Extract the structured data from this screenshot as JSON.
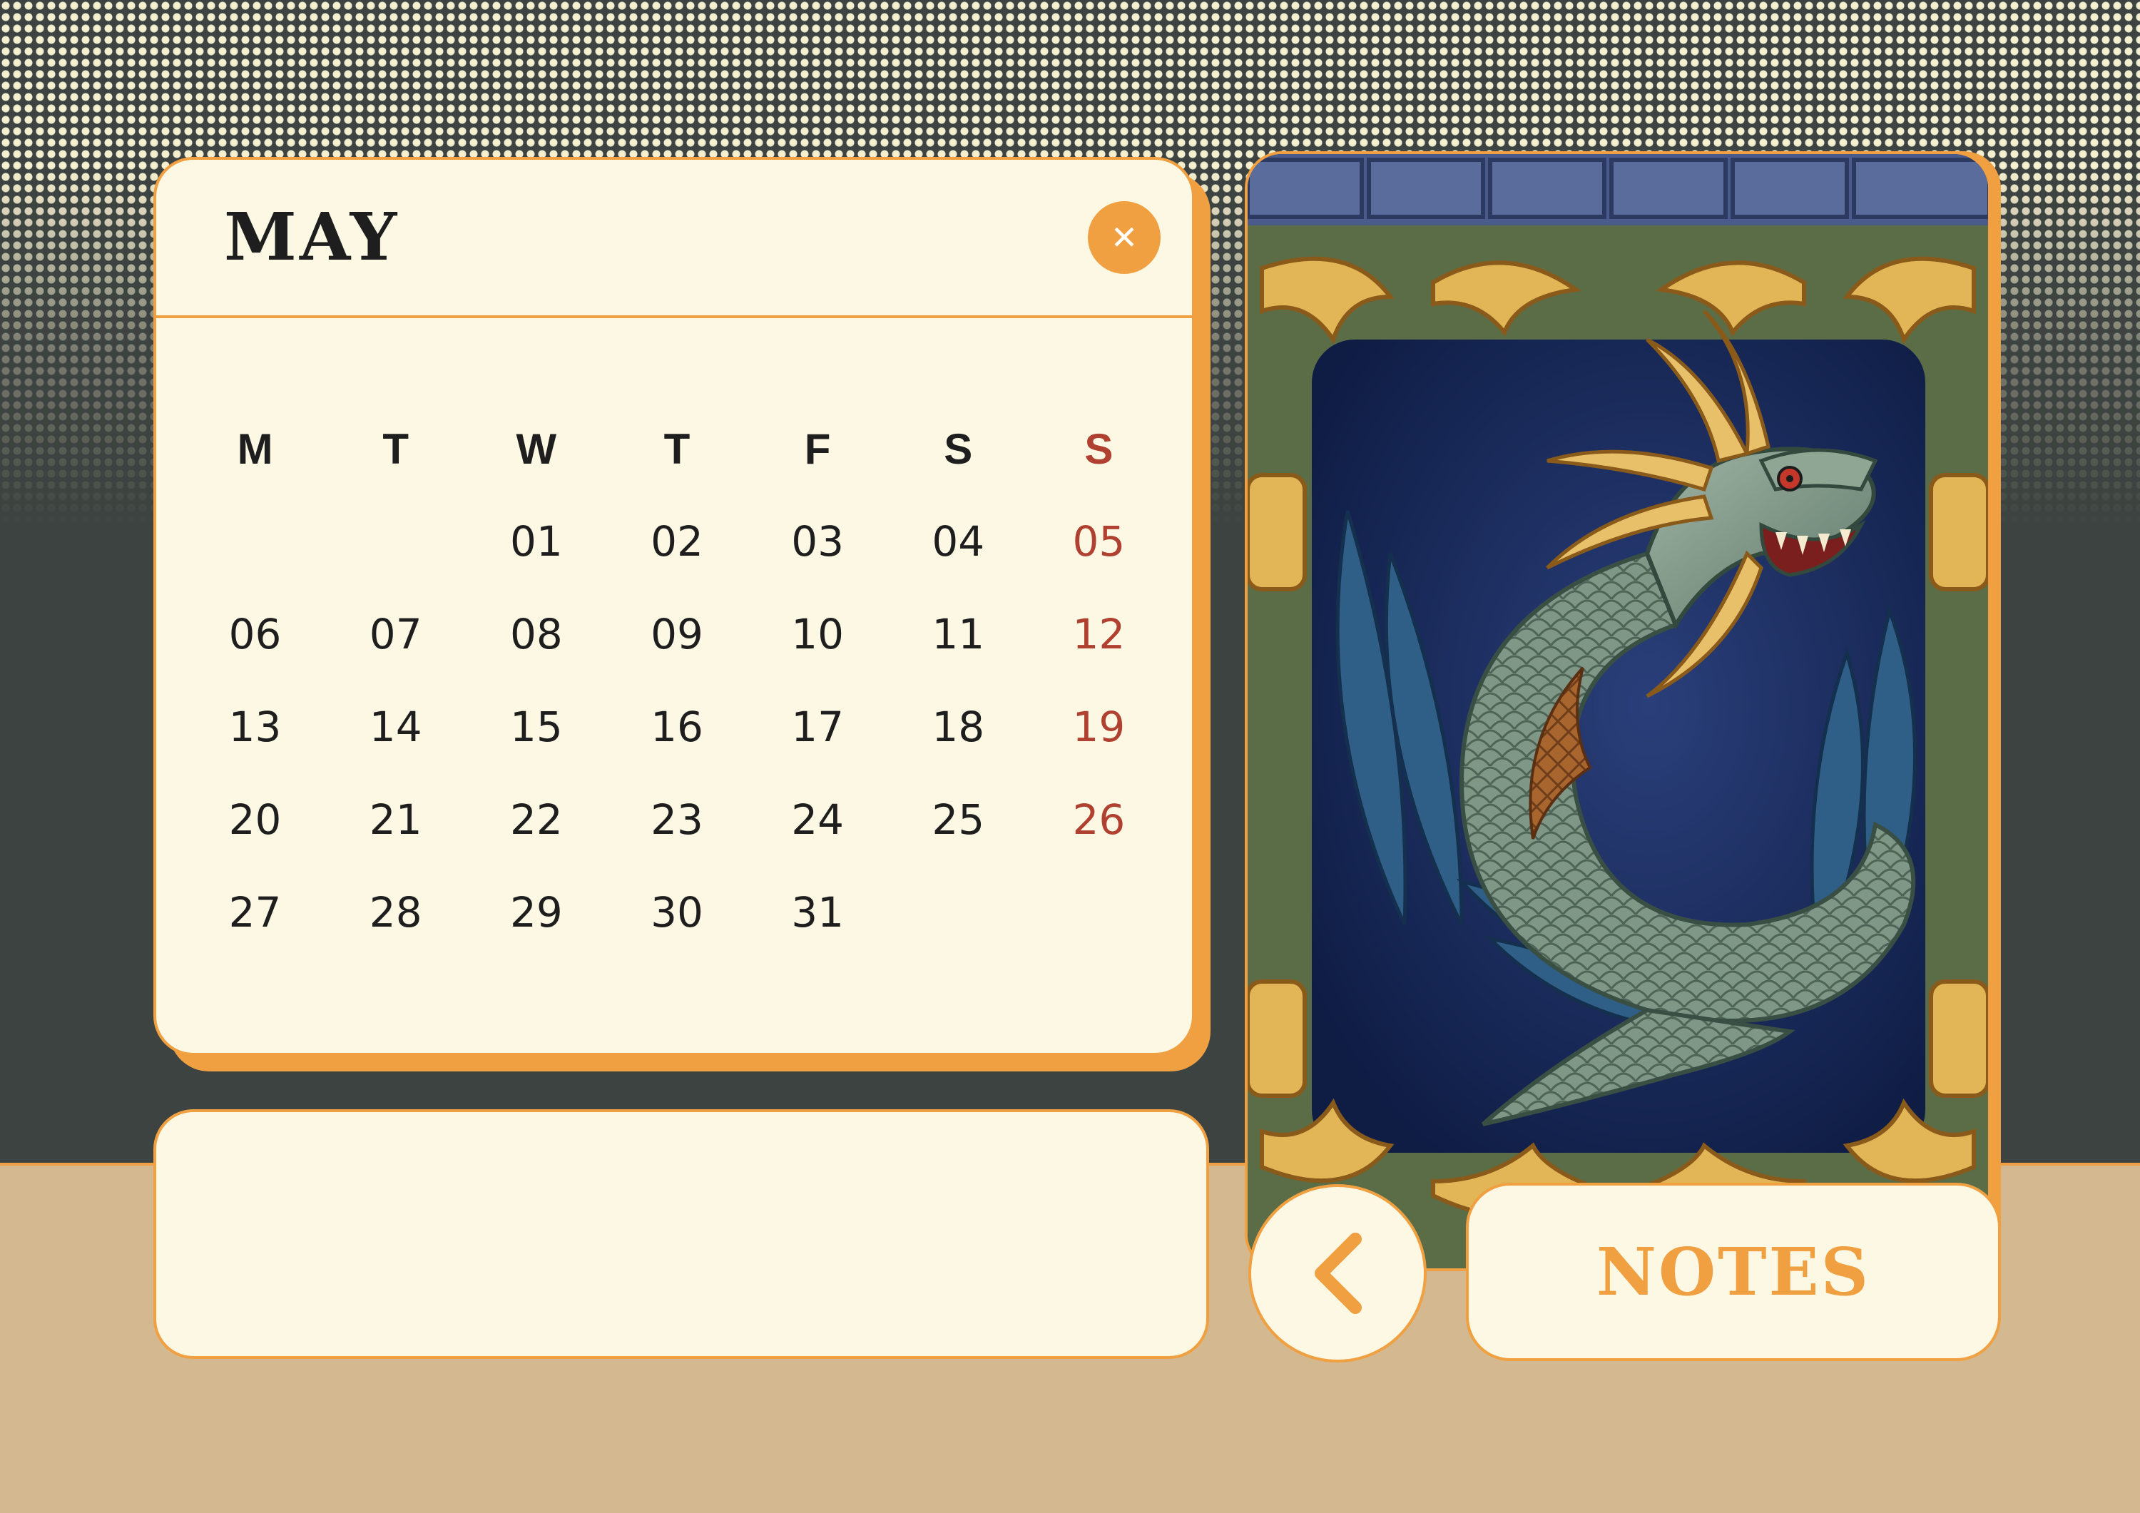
{
  "calendar": {
    "month": "MAY",
    "weekdays": [
      {
        "label": "M",
        "sunday": false
      },
      {
        "label": "T",
        "sunday": false
      },
      {
        "label": "W",
        "sunday": false
      },
      {
        "label": "T",
        "sunday": false
      },
      {
        "label": "F",
        "sunday": false
      },
      {
        "label": "S",
        "sunday": false
      },
      {
        "label": "S",
        "sunday": true
      }
    ],
    "weeks": [
      [
        "",
        "",
        "01",
        "02",
        "03",
        "04",
        "05"
      ],
      [
        "06",
        "07",
        "08",
        "09",
        "10",
        "11",
        "12"
      ],
      [
        "13",
        "14",
        "15",
        "16",
        "17",
        "18",
        "19"
      ],
      [
        "20",
        "21",
        "22",
        "23",
        "24",
        "25",
        "26"
      ],
      [
        "27",
        "28",
        "29",
        "30",
        "31",
        "",
        ""
      ]
    ]
  },
  "notes_button": {
    "label": "NOTES"
  },
  "icons": {
    "close": "close-icon",
    "back": "chevron-left-icon",
    "image": "dragon-tile-image"
  },
  "colors": {
    "accent": "#f0a040",
    "card": "#fcf8e4",
    "sunday": "#b04030",
    "text": "#1e1e1e",
    "background": "#3c4340",
    "floor": "#d4b890"
  }
}
